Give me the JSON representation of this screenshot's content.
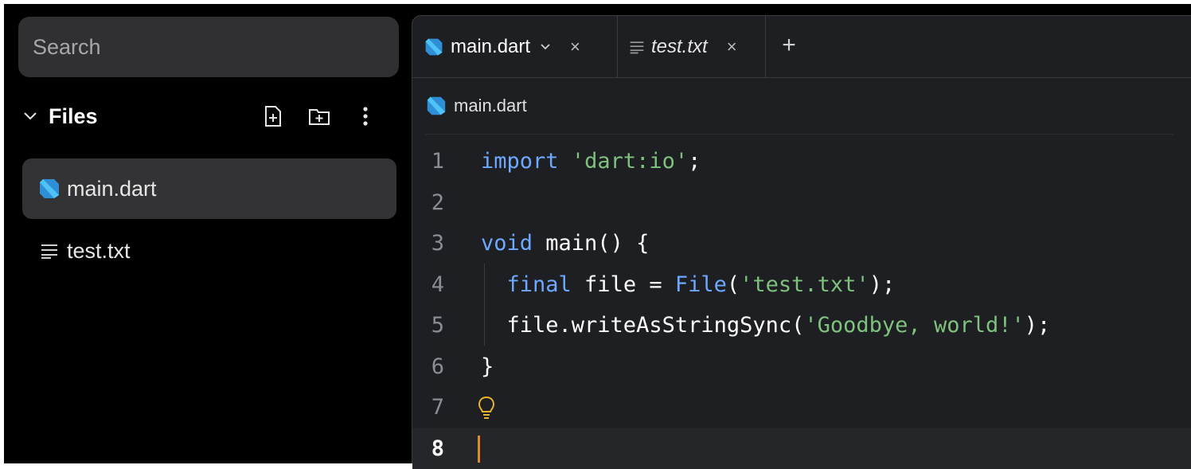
{
  "sidebar": {
    "search_placeholder": "Search",
    "files_title": "Files",
    "files": [
      {
        "name": "main.dart",
        "icon": "dart-icon",
        "active": true
      },
      {
        "name": "test.txt",
        "icon": "text-file-icon",
        "active": false
      }
    ]
  },
  "editor": {
    "tabs": [
      {
        "name": "main.dart",
        "icon": "dart-icon",
        "close": "×"
      },
      {
        "name": "test.txt",
        "icon": "text-file-icon",
        "close": "×"
      }
    ],
    "add_tab": "+",
    "breadcrumb": "main.dart",
    "lines": [
      {
        "num": "1",
        "text": "import 'dart:io';"
      },
      {
        "num": "2",
        "text": ""
      },
      {
        "num": "3",
        "text": "void main() {"
      },
      {
        "num": "4",
        "text": "  final file = File('test.txt');"
      },
      {
        "num": "5",
        "text": "  file.writeAsStringSync('Goodbye, world!');"
      },
      {
        "num": "6",
        "text": "}"
      },
      {
        "num": "7",
        "text": ""
      },
      {
        "num": "8",
        "text": ""
      }
    ],
    "current_line": "8"
  },
  "colors": {
    "background": "#000000",
    "editor_bg": "#1e1f22",
    "keyword": "#6fa8ff",
    "string": "#7ec27e",
    "cursor": "#e08a2c",
    "bulb": "#e8b52a"
  }
}
